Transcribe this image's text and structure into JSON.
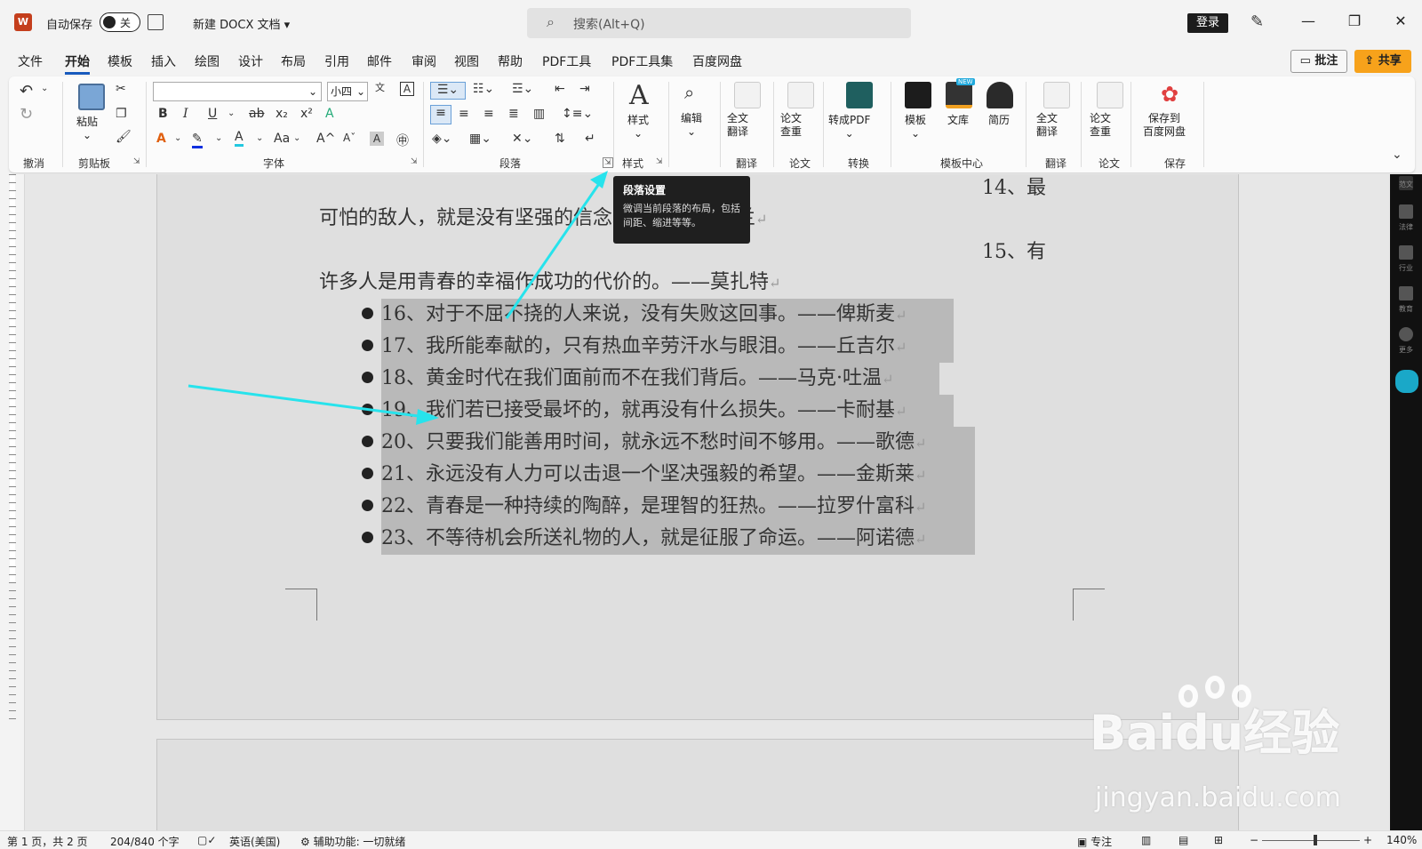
{
  "titlebar": {
    "logo": "W",
    "autosave_label": "自动保存",
    "autosave_state": "关",
    "doc_name": "新建 DOCX 文档",
    "search_placeholder": "搜索(Alt+Q)",
    "login": "登录"
  },
  "menu": [
    "文件",
    "开始",
    "模板",
    "插入",
    "绘图",
    "设计",
    "布局",
    "引用",
    "邮件",
    "审阅",
    "视图",
    "帮助",
    "PDF工具",
    "PDF工具集",
    "百度网盘"
  ],
  "active_menu": "开始",
  "actions": {
    "comment": "批注",
    "share": "共享"
  },
  "ribbon": {
    "groups": [
      "撤消",
      "剪贴板",
      "字体",
      "段落",
      "样式",
      "翻译",
      "论文",
      "转换",
      "模板中心",
      "翻译",
      "论文",
      "保存"
    ],
    "paste": "粘贴",
    "font_size": "小四",
    "style": "样式",
    "edit": "编辑",
    "full_translate": "全文\n翻译",
    "paper_check": "论文\n查重",
    "to_pdf": "转成PDF",
    "template": "模板",
    "library": "文库",
    "resume": "简历",
    "full_translate2": "全文\n翻译",
    "paper_check2": "论文\n查重",
    "save_baidu": "保存到\n百度网盘",
    "new_badge": "NEW"
  },
  "tooltip": {
    "title": "段落设置",
    "desc": "微调当前段落的布局，包括间距、缩进等等。"
  },
  "document": {
    "side_items": [
      "14、最",
      "15、有"
    ],
    "para1": "可怕的敌人，就是没有坚强的信念。——罗曼·罗兰",
    "para2": "许多人是用青春的幸福作成功的代价的。——莫扎特",
    "list": [
      "16、对于不屈不挠的人来说，没有失败这回事。——俾斯麦",
      "17、我所能奉献的，只有热血辛劳汗水与眼泪。——丘吉尔",
      "18、黄金时代在我们面前而不在我们背后。——马克·吐温",
      "19、我们若已接受最坏的，就再没有什么损失。——卡耐基",
      "20、只要我们能善用时间，就永远不愁时间不够用。——歌德",
      "21、永远没有人力可以击退一个坚决强毅的希望。——金斯莱",
      "22、青春是一种持续的陶醉，是理智的狂热。——拉罗什富科",
      "23、不等待机会所送礼物的人，就是征服了命运。——阿诺德"
    ]
  },
  "right_panel": [
    "范文",
    "法律",
    "行业",
    "教育",
    "更多"
  ],
  "status": {
    "page": "第 1 页，共 2 页",
    "words": "204/840 个字",
    "language": "英语(美国)",
    "accessibility": "辅助功能: 一切就绪",
    "focus": "专注",
    "zoom": "140%"
  },
  "watermark": {
    "brand": "Baidu经验",
    "url": "jingyan.baidu.com"
  },
  "colors": {
    "accent": "#185abd",
    "share": "#f7a21b",
    "arrow": "#27e3ec",
    "selection": "#b9b9b9"
  }
}
